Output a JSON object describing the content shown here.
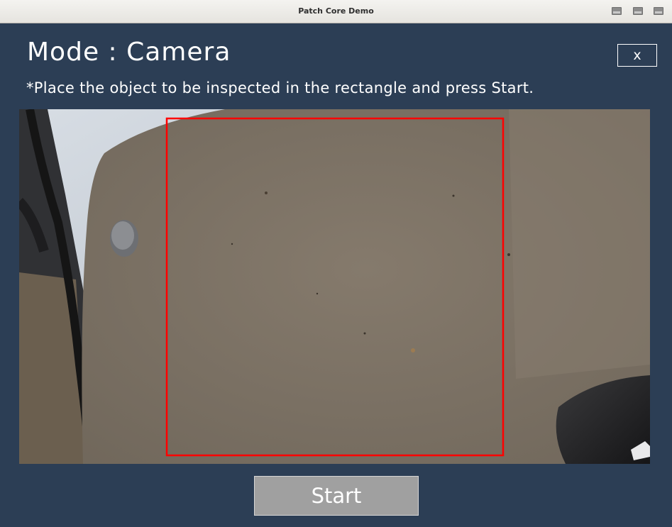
{
  "window": {
    "title": "Patch Core Demo",
    "controls": [
      "minimize-icon",
      "maximize-icon",
      "close-window-icon"
    ]
  },
  "header": {
    "mode_title": "Mode : Camera",
    "instruction": "*Place the object to be inspected in the rectangle and press Start.",
    "close_label": "x"
  },
  "camera": {
    "inspection_rect_color": "#ff0000",
    "surface_color": "#7e7366"
  },
  "actions": {
    "start_label": "Start"
  }
}
